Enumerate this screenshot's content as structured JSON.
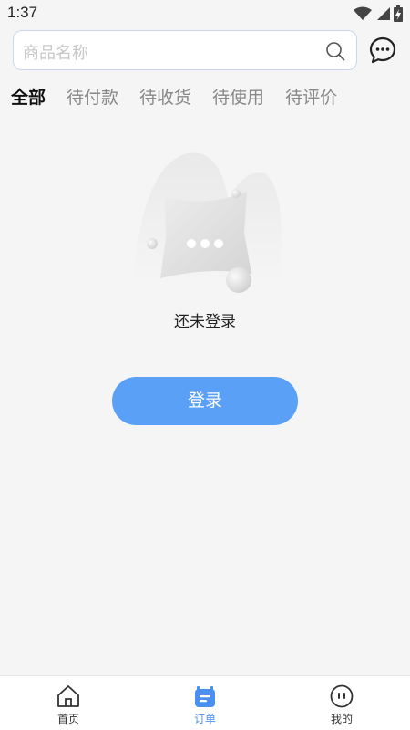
{
  "status_bar": {
    "time": "1:37"
  },
  "search": {
    "placeholder": "商品名称"
  },
  "tabs": [
    {
      "label": "全部",
      "active": true
    },
    {
      "label": "待付款",
      "active": false
    },
    {
      "label": "待收货",
      "active": false
    },
    {
      "label": "待使用",
      "active": false
    },
    {
      "label": "待评价",
      "active": false
    }
  ],
  "empty_state": {
    "message": "还未登录",
    "button_label": "登录"
  },
  "bottom_nav": [
    {
      "label": "首页",
      "icon": "home-icon",
      "active": false
    },
    {
      "label": "订单",
      "icon": "order-icon",
      "active": true
    },
    {
      "label": "我的",
      "icon": "profile-icon",
      "active": false
    }
  ],
  "colors": {
    "accent": "#5aa0f7",
    "tab_active": "#111111",
    "tab_inactive": "#888888"
  }
}
